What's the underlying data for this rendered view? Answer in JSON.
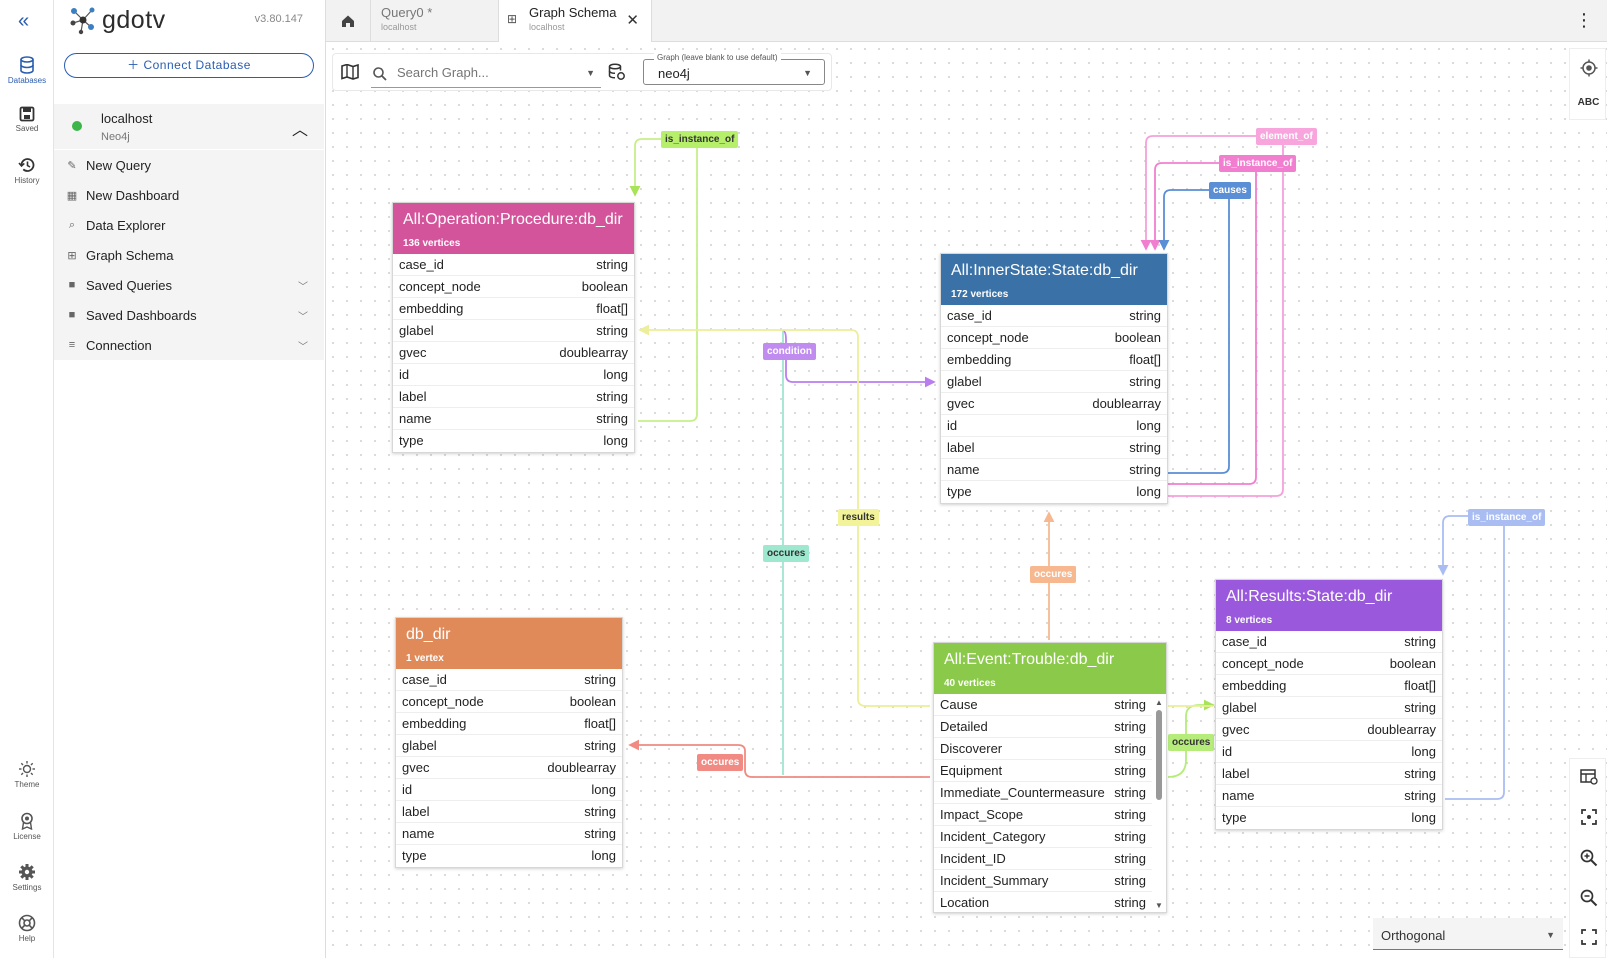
{
  "app": {
    "name": "gdotv",
    "version": "v3.80.147"
  },
  "rail": {
    "databases": "Databases",
    "saved": "Saved",
    "history": "History",
    "theme": "Theme",
    "license": "License",
    "settings": "Settings",
    "help": "Help"
  },
  "sidebar": {
    "connect_label": "Connect Database",
    "connection": {
      "name": "localhost",
      "type": "Neo4j"
    },
    "items": [
      {
        "label": "New Query"
      },
      {
        "label": "New Dashboard"
      },
      {
        "label": "Data Explorer"
      },
      {
        "label": "Graph Schema"
      },
      {
        "label": "Saved Queries"
      },
      {
        "label": "Saved Dashboards"
      },
      {
        "label": "Connection"
      }
    ]
  },
  "tabs": [
    {
      "title": "Query0 *",
      "sub": "localhost"
    },
    {
      "title": "Graph Schema",
      "sub": "localhost"
    }
  ],
  "toolbar": {
    "search_placeholder": "Search Graph...",
    "graph_legend": "Graph (leave blank to use default)",
    "graph_value": "neo4j"
  },
  "colors": {
    "procedure": "#d4549c",
    "innerstate": "#3a72a8",
    "dbdir": "#e08a5a",
    "event": "#8bc94a",
    "results": "#9a58dd",
    "accent": "#2a5db0"
  },
  "entities": {
    "procedure": {
      "title": "All:Operation:Procedure:db_dir",
      "count": "136 vertices",
      "rows": [
        [
          "case_id",
          "string"
        ],
        [
          "concept_node",
          "boolean"
        ],
        [
          "embedding",
          "float[]"
        ],
        [
          "glabel",
          "string"
        ],
        [
          "gvec",
          "doublearray"
        ],
        [
          "id",
          "long"
        ],
        [
          "label",
          "string"
        ],
        [
          "name",
          "string"
        ],
        [
          "type",
          "long"
        ]
      ]
    },
    "innerstate": {
      "title": "All:InnerState:State:db_dir",
      "count": "172 vertices",
      "rows": [
        [
          "case_id",
          "string"
        ],
        [
          "concept_node",
          "boolean"
        ],
        [
          "embedding",
          "float[]"
        ],
        [
          "glabel",
          "string"
        ],
        [
          "gvec",
          "doublearray"
        ],
        [
          "id",
          "long"
        ],
        [
          "label",
          "string"
        ],
        [
          "name",
          "string"
        ],
        [
          "type",
          "long"
        ]
      ]
    },
    "dbdir": {
      "title": "db_dir",
      "count": "1 vertex",
      "rows": [
        [
          "case_id",
          "string"
        ],
        [
          "concept_node",
          "boolean"
        ],
        [
          "embedding",
          "float[]"
        ],
        [
          "glabel",
          "string"
        ],
        [
          "gvec",
          "doublearray"
        ],
        [
          "id",
          "long"
        ],
        [
          "label",
          "string"
        ],
        [
          "name",
          "string"
        ],
        [
          "type",
          "long"
        ]
      ]
    },
    "event": {
      "title": "All:Event:Trouble:db_dir",
      "count": "40 vertices",
      "rows": [
        [
          "Cause",
          "string"
        ],
        [
          "Detailed",
          "string"
        ],
        [
          "Discoverer",
          "string"
        ],
        [
          "Equipment",
          "string"
        ],
        [
          "Immediate_Countermeasure",
          "string"
        ],
        [
          "Impact_Scope",
          "string"
        ],
        [
          "Incident_Category",
          "string"
        ],
        [
          "Incident_ID",
          "string"
        ],
        [
          "Incident_Summary",
          "string"
        ],
        [
          "Location",
          "string"
        ]
      ]
    },
    "results": {
      "title": "All:Results:State:db_dir",
      "count": "8 vertices",
      "rows": [
        [
          "case_id",
          "string"
        ],
        [
          "concept_node",
          "boolean"
        ],
        [
          "embedding",
          "float[]"
        ],
        [
          "glabel",
          "string"
        ],
        [
          "gvec",
          "doublearray"
        ],
        [
          "id",
          "long"
        ],
        [
          "label",
          "string"
        ],
        [
          "name",
          "string"
        ],
        [
          "type",
          "long"
        ]
      ]
    }
  },
  "edges": {
    "is_instance_of_1": "is_instance_of",
    "element_of": "element_of",
    "is_instance_of_2": "is_instance_of",
    "causes": "causes",
    "condition": "condition",
    "results": "results",
    "occures_1": "occures",
    "occures_2": "occures",
    "occures_3": "occures",
    "occures_4": "occures",
    "is_instance_of_3": "is_instance_of"
  },
  "tools": {
    "abc": "ABC"
  },
  "layout": {
    "value": "Orthogonal"
  }
}
